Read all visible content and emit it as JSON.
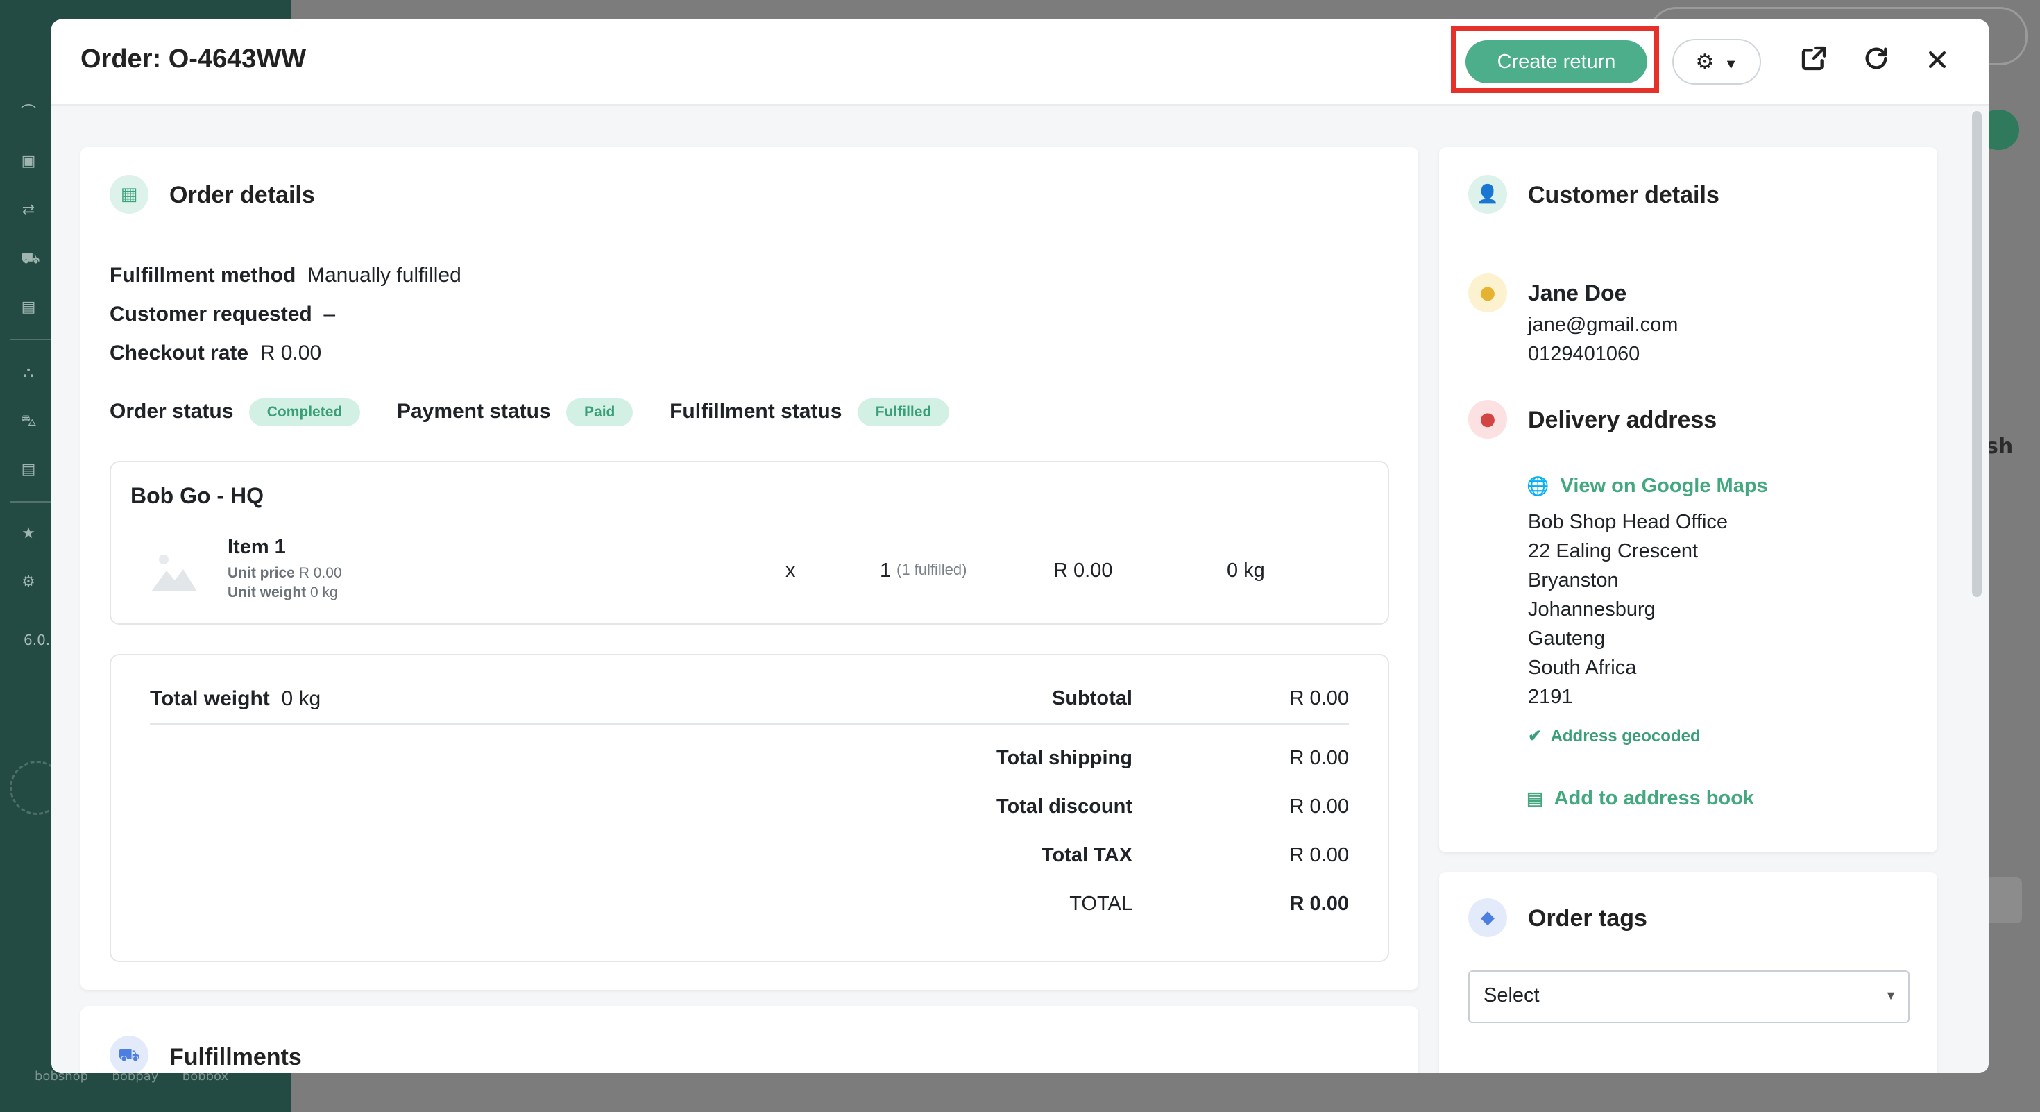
{
  "modal": {
    "title": "Order: O-4643WW",
    "create_return_label": "Create return"
  },
  "order_details": {
    "title": "Order details",
    "fulfillment_method_label": "Fulfillment method",
    "fulfillment_method_value": "Manually fulfilled",
    "customer_requested_label": "Customer requested",
    "customer_requested_value": "–",
    "checkout_rate_label": "Checkout rate",
    "checkout_rate_value": "R 0.00",
    "order_status_label": "Order status",
    "order_status_badge": "Completed",
    "payment_status_label": "Payment status",
    "payment_status_badge": "Paid",
    "fulfillment_status_label": "Fulfillment status",
    "fulfillment_status_badge": "Fulfilled"
  },
  "location": {
    "name": "Bob Go - HQ",
    "item": {
      "name": "Item 1",
      "unit_price_label": "Unit price",
      "unit_price_value": "R 0.00",
      "unit_weight_label": "Unit weight",
      "unit_weight_value": "0 kg",
      "times": "x",
      "qty": "1",
      "fulfilled_note": "(1 fulfilled)",
      "price": "R 0.00",
      "weight": "0 kg"
    }
  },
  "totals": {
    "total_weight_label": "Total weight",
    "total_weight_value": "0 kg",
    "rows": [
      {
        "label": "Subtotal",
        "value": "R 0.00"
      },
      {
        "label": "Total shipping",
        "value": "R 0.00"
      },
      {
        "label": "Total discount",
        "value": "R 0.00"
      },
      {
        "label": "Total TAX",
        "value": "R 0.00"
      },
      {
        "label": "TOTAL",
        "value": "R 0.00"
      }
    ]
  },
  "fulfillments": {
    "title": "Fulfillments"
  },
  "customer": {
    "title": "Customer details",
    "name": "Jane Doe",
    "email": "jane@gmail.com",
    "phone": "0129401060"
  },
  "delivery": {
    "title": "Delivery address",
    "map_link": "View on Google Maps",
    "lines": [
      "Bob Shop Head Office",
      "22 Ealing Crescent",
      "Bryanston",
      "Johannesburg",
      "Gauteng",
      "South Africa",
      "2191"
    ],
    "geocoded": "Address geocoded",
    "add_book": "Add to address book"
  },
  "tags": {
    "title": "Order tags",
    "select_value": "Select"
  },
  "background": {
    "version": "6.0.",
    "sh_text": "sh",
    "footer_links": [
      "bobshop",
      "bobpay",
      "bobbox"
    ]
  },
  "colors": {
    "accent": "#4cae8a",
    "highlight": "#e53129",
    "sidebar": "#234a43"
  }
}
